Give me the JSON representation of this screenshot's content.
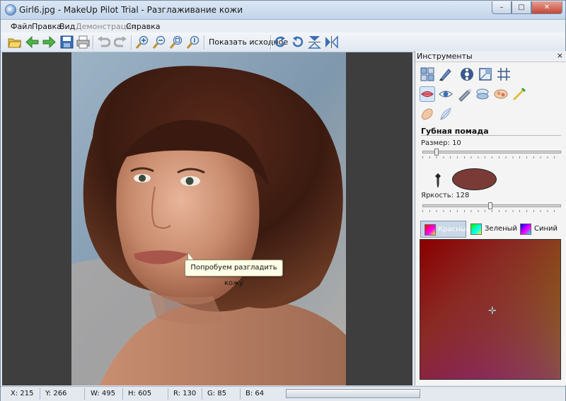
{
  "window": {
    "title": "Girl6.jpg - MakeUp Pilot Trial - Разглаживание кожи",
    "minimize": "–",
    "maximize": "□",
    "close": "✕"
  },
  "menu": {
    "file": "Файл",
    "edit": "Правка",
    "view": "Вид",
    "demo": "Демонстрация",
    "help": "Справка"
  },
  "toolbar": {
    "show_original": "Показать исходное"
  },
  "canvas": {
    "tooltip": "Попробуем разгладить кожу"
  },
  "panel": {
    "title": "Инструменты",
    "close": "×",
    "section_title": "Губная помада",
    "size_label": "Размер: 10",
    "size_value": 10,
    "brightness_label": "Яркость: 128",
    "brightness_value": 128,
    "selected_color": "#7a3a36",
    "channels": {
      "red": "Красный",
      "green": "Зеленый",
      "blue": "Синий",
      "active": "red"
    }
  },
  "status": {
    "x": "X: 215",
    "y": "Y: 266",
    "w": "W: 495",
    "h": "H: 605",
    "r": "R: 130",
    "g": "G: 85",
    "b": "B: 64"
  }
}
